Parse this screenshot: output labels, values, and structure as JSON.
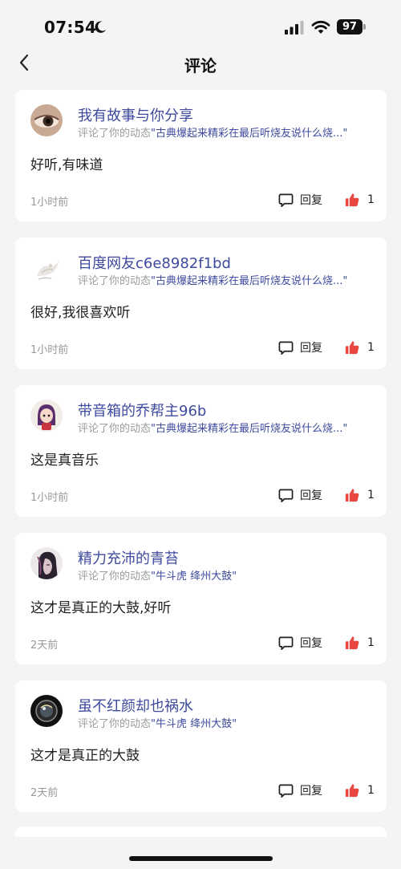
{
  "status_bar": {
    "time": "07:54",
    "battery_level": "97"
  },
  "nav": {
    "title": "评论"
  },
  "comments": [
    {
      "username": "我有故事与你分享",
      "action_prefix": "评论了你的动态",
      "quote": "\"古典爆起来精彩在最后听烧友说什么烧...\"",
      "text": "好听,有味道",
      "time": "1小时前",
      "reply_label": "回复",
      "likes": "1",
      "avatar": "eye"
    },
    {
      "username": "百度网友c6e8982f1bd",
      "action_prefix": "评论了你的动态",
      "quote": "\"古典爆起来精彩在最后听烧友说什么烧...\"",
      "text": "很好,我很喜欢听",
      "time": "1小时前",
      "reply_label": "回复",
      "likes": "1",
      "avatar": "bird"
    },
    {
      "username": "带音箱的乔帮主96b",
      "action_prefix": "评论了你的动态",
      "quote": "\"古典爆起来精彩在最后听烧友说什么烧...\"",
      "text": "这是真音乐",
      "time": "1小时前",
      "reply_label": "回复",
      "likes": "1",
      "avatar": "girl"
    },
    {
      "username": "精力充沛的青苔",
      "action_prefix": "评论了你的动态",
      "quote": "\"牛斗虎 绛州大鼓\"",
      "text": "这才是真正的大鼓,好听",
      "time": "2天前",
      "reply_label": "回复",
      "likes": "1",
      "avatar": "portrait"
    },
    {
      "username": "虽不红颜却也祸水",
      "action_prefix": "评论了你的动态",
      "quote": "\"牛斗虎 绛州大鼓\"",
      "text": "这才是真正的大鼓",
      "time": "2天前",
      "reply_label": "回复",
      "likes": "1",
      "avatar": "orb"
    }
  ],
  "colors": {
    "accent": "#3d4a9e",
    "like": "#e8463f",
    "background": "#f4f4f6"
  }
}
